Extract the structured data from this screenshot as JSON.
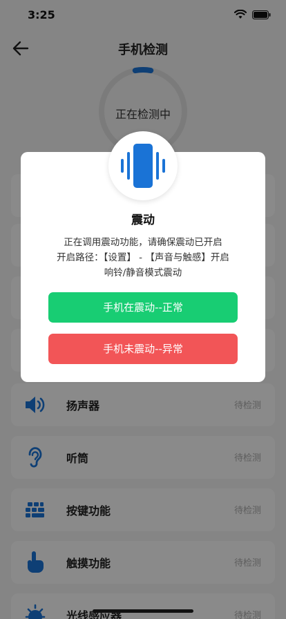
{
  "status_bar": {
    "time": "3:25"
  },
  "nav": {
    "title": "手机检测"
  },
  "progress": {
    "label": "正在检测中",
    "value": 0.06
  },
  "list": [
    {
      "name": "扬声器",
      "status": "待检测",
      "icon": "speaker-icon"
    },
    {
      "name": "听筒",
      "status": "待检测",
      "icon": "ear-icon"
    },
    {
      "name": "按键功能",
      "status": "待检测",
      "icon": "keys-icon"
    },
    {
      "name": "触摸功能",
      "status": "待检测",
      "icon": "touch-icon"
    },
    {
      "name": "光线感应器",
      "status": "待检测",
      "icon": "light-sensor-icon"
    }
  ],
  "modal": {
    "title": "震动",
    "desc_line1": "正在调用震动功能，请确保震动已开启",
    "desc_line2": "开启路径：【设置】 - 【声音与触感】开启",
    "desc_line3": "响铃/静音模式震动",
    "btn_ok": "手机在震动--正常",
    "btn_bad": "手机未震动--异常",
    "icon": "vibration-icon"
  },
  "colors": {
    "accent": "#1a73d6",
    "ok": "#18cd73",
    "bad": "#f25557"
  }
}
